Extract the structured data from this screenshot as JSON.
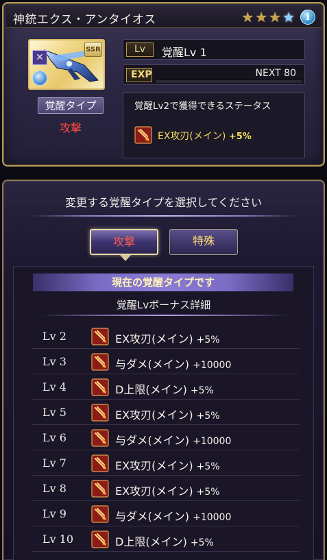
{
  "weapon": {
    "name": "神銃エクス・アンタイオス",
    "stars": [
      "gold",
      "gold",
      "gold",
      "blue"
    ],
    "rarity_badge": "SSR",
    "element_icon": "cross-swords-icon"
  },
  "awaken": {
    "type_label": "覚醒タイプ",
    "type_value": "攻撃",
    "lv_tag": "Lv",
    "lv_value": "覚醒Lv 1",
    "exp_tag": "EXP",
    "next_label": "NEXT 80",
    "exp_progress": 0.0
  },
  "next_stats": {
    "title": "覚醒Lv2で獲得できるステータス",
    "stat_name": "EX攻刃(メイン)",
    "stat_value": "+5%"
  },
  "select": {
    "prompt": "変更する覚醒タイプを選択してください",
    "tabs": [
      {
        "label": "攻撃",
        "selected": true
      },
      {
        "label": "特殊",
        "selected": false
      }
    ],
    "current_banner": "現在の覚醒タイプです",
    "bonus_title": "覚醒Lvボーナス詳細"
  },
  "bonus_rows": [
    {
      "lv": "Lv 2",
      "name": "EX攻刃(メイン)",
      "value": "+5%"
    },
    {
      "lv": "Lv 3",
      "name": "与ダメ(メイン)",
      "value": "+10000"
    },
    {
      "lv": "Lv 4",
      "name": "D上限(メイン)",
      "value": "+5%"
    },
    {
      "lv": "Lv 5",
      "name": "EX攻刃(メイン)",
      "value": "+5%"
    },
    {
      "lv": "Lv 6",
      "name": "与ダメ(メイン)",
      "value": "+10000"
    },
    {
      "lv": "Lv 7",
      "name": "EX攻刃(メイン)",
      "value": "+5%"
    },
    {
      "lv": "Lv 8",
      "name": "EX攻刃(メイン)",
      "value": "+5%"
    },
    {
      "lv": "Lv 9",
      "name": "与ダメ(メイン)",
      "value": "+10000"
    },
    {
      "lv": "Lv 10",
      "name": "D上限(メイン)",
      "value": "+5%"
    }
  ],
  "colors": {
    "accent_gold": "#b39a5c",
    "attack_red": "#ff4a3f",
    "stat_yellow": "#f6de5a"
  }
}
